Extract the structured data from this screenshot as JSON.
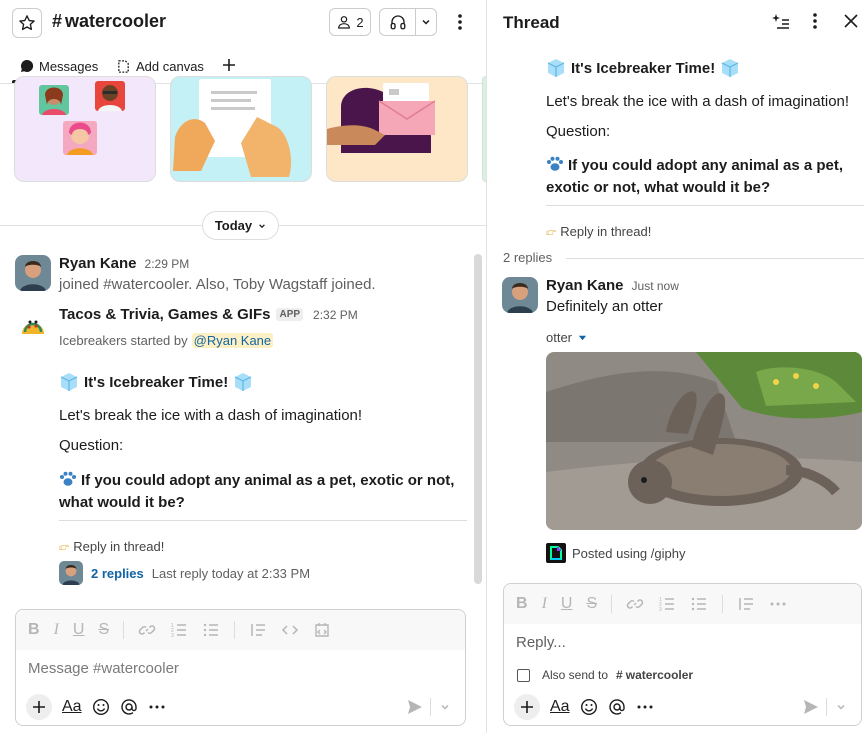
{
  "channel": {
    "name": "watercooler",
    "member_count": "2",
    "tabs": [
      {
        "label": "Messages",
        "icon": "message-bubble-icon"
      },
      {
        "label": "Add canvas",
        "icon": "canvas-icon"
      }
    ]
  },
  "divider": {
    "label": "Today"
  },
  "messages": [
    {
      "author": "Ryan Kane",
      "time": "2:29 PM",
      "text": "joined #watercooler. Also, Toby Wagstaff joined."
    },
    {
      "author": "Tacos & Trivia, Games & GIFs",
      "badge": "APP",
      "time": "2:32 PM",
      "started_prefix": "Icebreakers started by",
      "mention": "@Ryan Kane",
      "heading": "It's Icebreaker Time!",
      "intro": "Let's break the ice with a dash of imagination!",
      "question_label": "Question:",
      "question": "If you could adopt any animal as a pet, exotic or not, what would it be?",
      "reply_prompt": "Reply in thread!",
      "replies_link": "2 replies",
      "last_reply": "Last reply today at 2:33 PM"
    }
  ],
  "composer": {
    "placeholder": "Message #watercooler",
    "format_label": "Aa"
  },
  "thread": {
    "title": "Thread",
    "heading": "It's Icebreaker Time!",
    "intro": "Let's break the ice with a dash of imagination!",
    "question_label": "Question:",
    "question": "If you could adopt any animal as a pet, exotic or not, what would it be?",
    "reply_prompt": "Reply in thread!",
    "reply_count": "2 replies",
    "reply": {
      "author": "Ryan Kane",
      "time": "Just now",
      "text": "Definitely an otter",
      "attachment_label": "otter",
      "giphy_text": "Posted using /giphy"
    },
    "composer_placeholder": "Reply...",
    "also_send_prefix": "Also send to",
    "also_send_channel": "watercooler",
    "format_label": "Aa"
  },
  "colors": {
    "link": "#1264a3",
    "mention_bg": "#fdf0c4",
    "card_purple": "#f3e8fb",
    "card_cyan": "#c3f1f5",
    "card_peach": "#fde7c6"
  }
}
